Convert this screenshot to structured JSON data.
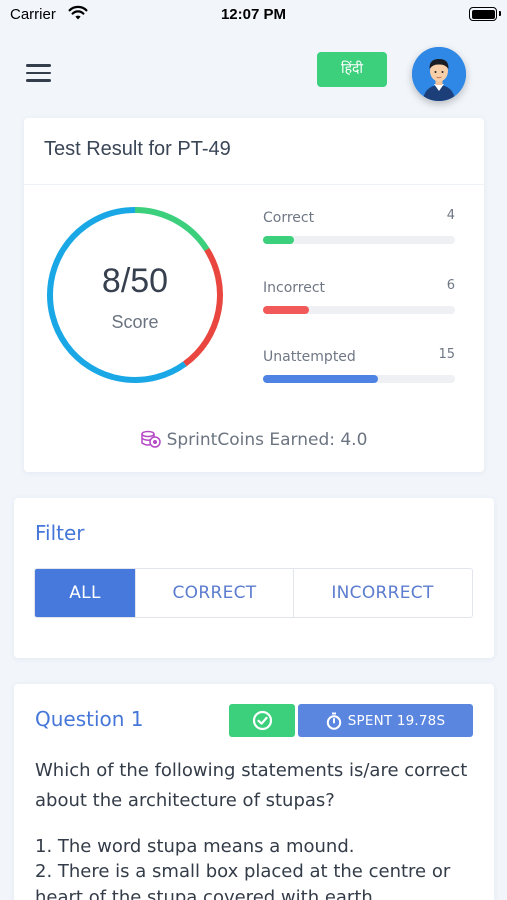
{
  "status_bar": {
    "carrier": "Carrier",
    "time": "12:07 PM"
  },
  "header": {
    "language_button": "हिंदी",
    "menu_icon": "hamburger-menu-icon",
    "avatar_icon": "user-avatar-icon"
  },
  "result": {
    "title": "Test Result for PT-49",
    "score": "8/50",
    "score_label": "Score",
    "stats": [
      {
        "label": "Correct",
        "count": "4",
        "fraction": 0.16,
        "color": "#3ccf7c"
      },
      {
        "label": "Incorrect",
        "count": "6",
        "fraction": 0.24,
        "color": "#f25a5a"
      },
      {
        "label": "Unattempted",
        "count": "15",
        "fraction": 0.6,
        "color": "#4f83e3"
      }
    ],
    "ring": {
      "correct_fraction": 0.16,
      "incorrect_fraction": 0.24,
      "correct_color": "#3ccf7c",
      "incorrect_color": "#e8463f",
      "unattempted_color": "#1aa7e6"
    },
    "coins_icon": "coins-icon",
    "coins_text": "SprintCoins Earned: 4.0"
  },
  "filter": {
    "title": "Filter",
    "options": [
      "ALL",
      "CORRECT",
      "INCORRECT"
    ],
    "selected": "ALL"
  },
  "question": {
    "title": "Question 1",
    "status_icon": "check-circle-icon",
    "time_icon": "stopwatch-icon",
    "time_spent": "SPENT 19.78S",
    "text": "Which of the following statements is/are correct about the architecture of stupas?",
    "options": [
      "1. The word stupa means a mound.",
      "2. There is a small box placed at the centre or heart of the stupa covered with earth."
    ]
  }
}
